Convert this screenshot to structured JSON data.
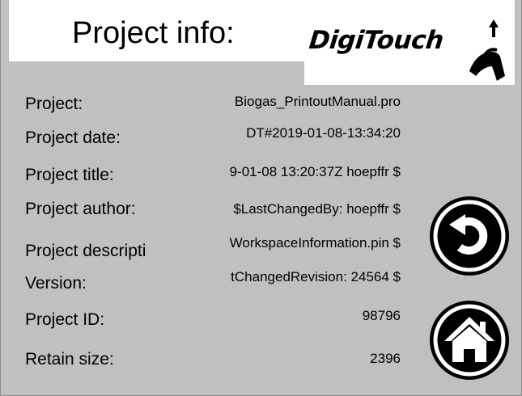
{
  "header": {
    "title": "Project info:",
    "logo_text": "DigiTouch"
  },
  "rows": [
    {
      "label": "Project:",
      "value": "Biogas_PrintoutManual.pro"
    },
    {
      "label": "Project date:",
      "value": "DT#2019-01-08-13:34:20"
    },
    {
      "label": "Project title:",
      "value": "9-01-08 13:20:37Z hoepffr $"
    },
    {
      "label": "Project author:",
      "value": "$LastChangedBy: hoepffr $"
    },
    {
      "label": "Project descripti",
      "value": "WorkspaceInformation.pin $"
    },
    {
      "label": "Version:",
      "value": "tChangedRevision: 24564 $"
    },
    {
      "label": "Project ID:",
      "value": "98796"
    },
    {
      "label": "Retain size:",
      "value": "2396"
    }
  ],
  "buttons": {
    "back_icon": "undo-arrow-icon",
    "home_icon": "home-icon"
  },
  "colors": {
    "panel": "#c0c0c0",
    "header": "#ffffff",
    "button": "#000000"
  }
}
